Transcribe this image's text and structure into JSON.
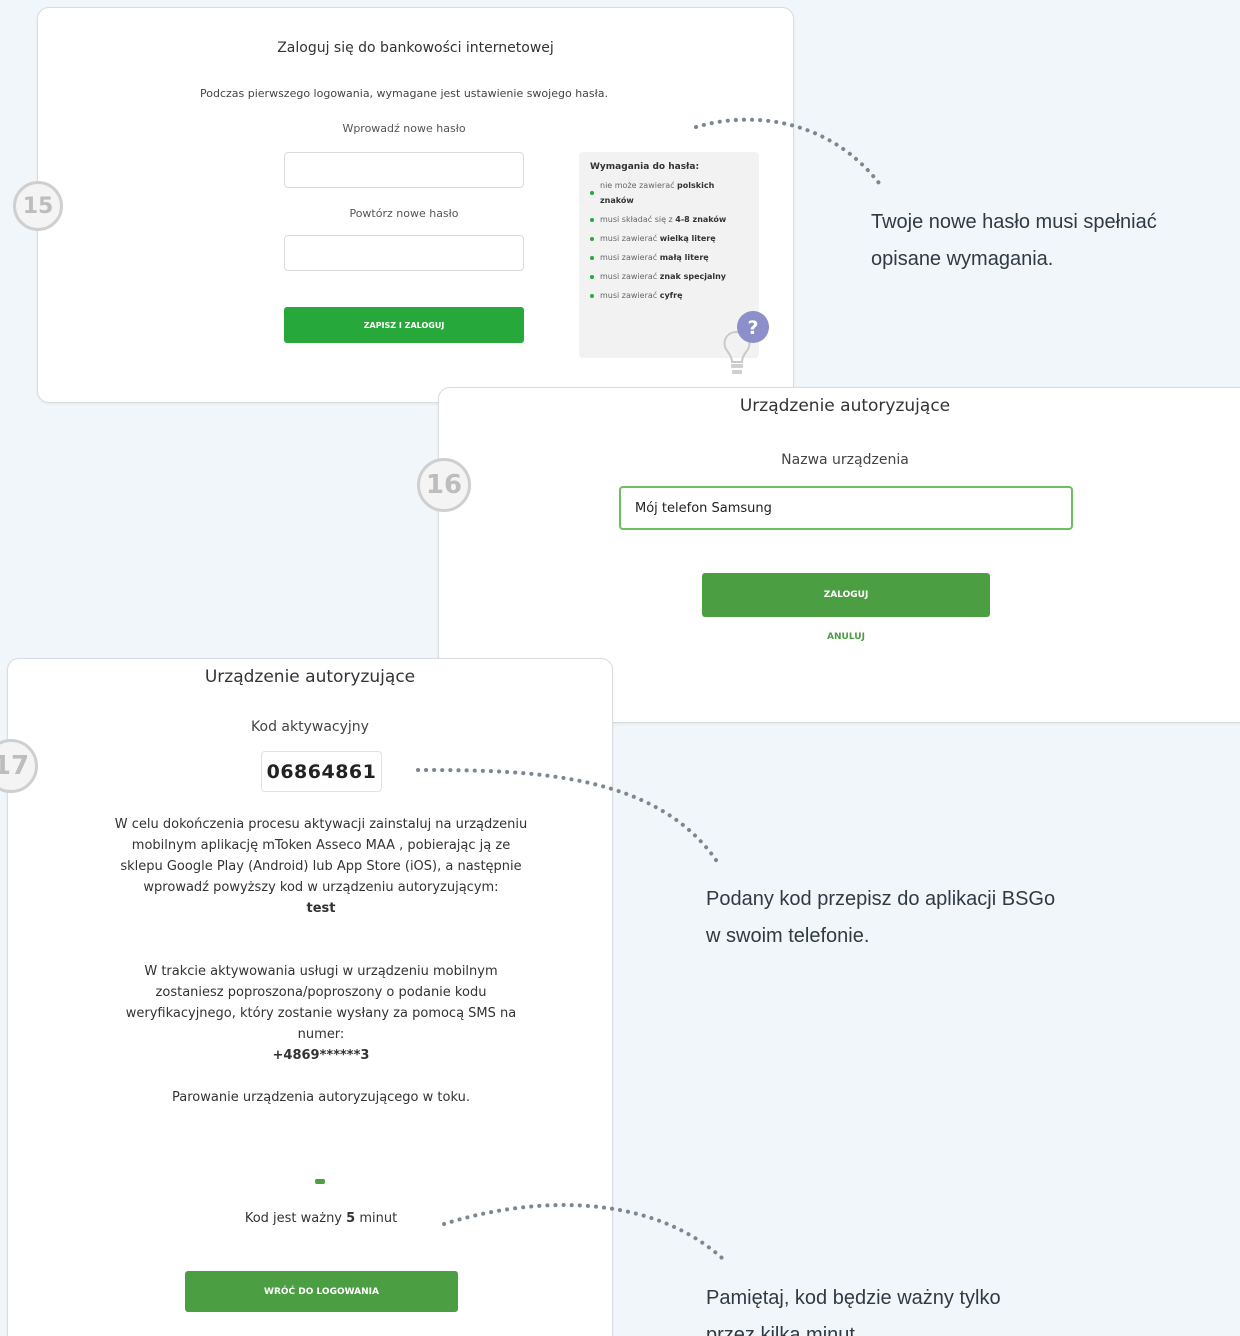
{
  "step15": {
    "number": "15",
    "title": "Zaloguj się do bankowości internetowej",
    "subtitle": "Podczas pierwszego logowania, wymagane jest ustawienie swojego hasła.",
    "new_password_label": "Wprowadź nowe hasło",
    "new_password_value": "",
    "repeat_password_label": "Powtórz nowe hasło",
    "repeat_password_value": "",
    "save_button": "ZAPISZ I ZALOGUJ",
    "requirements": {
      "title": "Wymagania do hasła:",
      "items": [
        {
          "text": "nie może zawierać ",
          "bold": "polskich znaków"
        },
        {
          "text": "musi składać się z ",
          "bold": "4-8 znaków"
        },
        {
          "text": "musi zawierać ",
          "bold": "wielką literę"
        },
        {
          "text": "musi zawierać ",
          "bold": "małą literę"
        },
        {
          "text": "musi zawierać ",
          "bold": "znak specjalny"
        },
        {
          "text": "musi zawierać ",
          "bold": "cyfrę"
        }
      ]
    },
    "help_icon": "question-bulb-icon"
  },
  "step16": {
    "number": "16",
    "title": "Urządzenie autoryzujące",
    "device_name_label": "Nazwa urządzenia",
    "device_name_value": "Mój telefon Samsung",
    "login_button": "ZALOGUJ",
    "cancel_link": "ANULUJ"
  },
  "step17": {
    "number": "17",
    "title": "Urządzenie autoryzujące",
    "activation_code_label": "Kod aktywacyjny",
    "activation_code": "06864861",
    "instructions": "W celu dokończenia procesu aktywacji zainstaluj na urządzeniu mobilnym aplikację mToken Asseco MAA , pobierając ją ze sklepu Google Play (Android) lub App Store (iOS), a następnie wprowadź powyższy kod w urządzeniu autoryzującym:",
    "device_name": "test",
    "sms_info": "W trakcie aktywowania usługi w urządzeniu mobilnym zostaniesz poproszona/poproszony o podanie kodu weryfikacyjnego, który zostanie wysłany za pomocą SMS na numer:",
    "phone": "+4869******3",
    "pairing_status": "Parowanie urządzenia autoryzującego w toku.",
    "valid_prefix": "Kod jest ważny ",
    "valid_minutes": "5",
    "valid_suffix": " minut",
    "back_button": "WRÓĆ DO LOGOWANIA"
  },
  "annotations": {
    "a1_line1": "Twoje nowe hasło musi spełniać",
    "a1_line2": "opisane wymagania.",
    "a2_line1": "Podany kod przepisz do aplikacji BSGo",
    "a2_line2": "w swoim telefonie.",
    "a3_line1": "Pamiętaj, kod będzie ważny tylko",
    "a3_line2": "przez kilka minut."
  },
  "colors": {
    "background": "#f1f6fa",
    "primary_green": "#27a83a",
    "secondary_green": "#4c9e43",
    "step_badge": "#cfcfcf",
    "help_icon": "#8c8fc9"
  }
}
